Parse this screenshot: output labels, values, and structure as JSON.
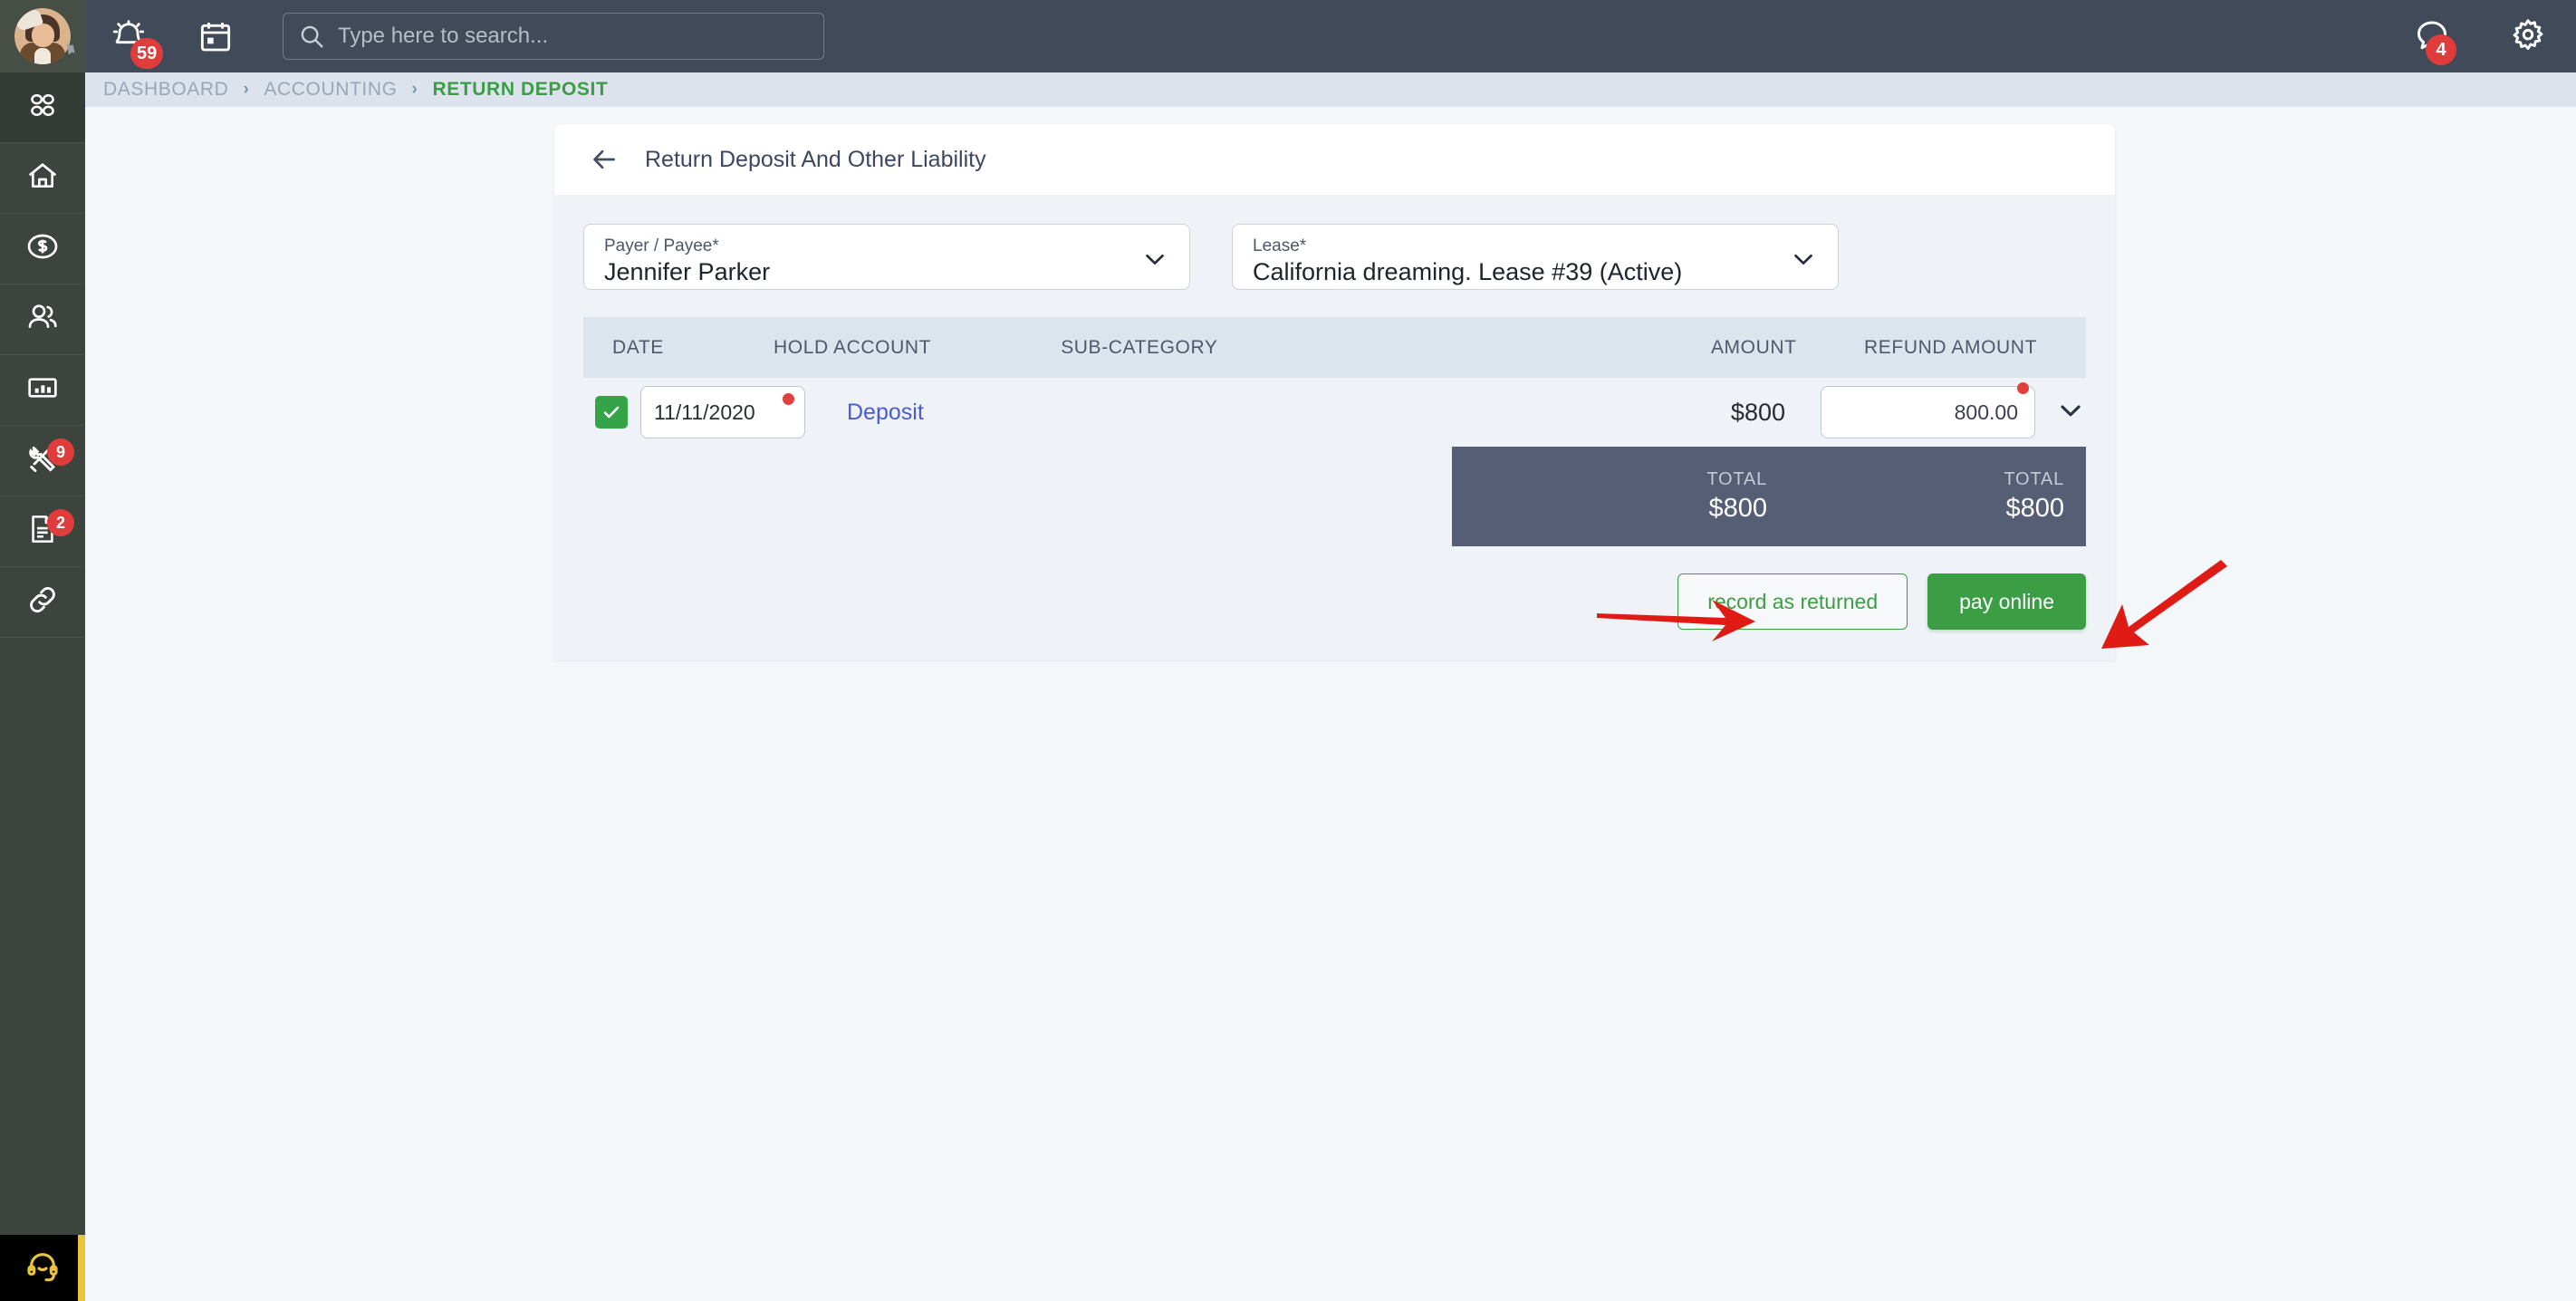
{
  "topbar": {
    "avatar_name": "user-avatar",
    "alarm_badge": "59",
    "chat_badge": "4",
    "search_placeholder": "Type here to search...",
    "search_value": "",
    "icons": {
      "alarm": "alarm-clock-icon",
      "calendar": "calendar-icon",
      "search": "search-icon",
      "chat": "chat-bubble-icon",
      "gear": "gear-icon",
      "pin": "pin-icon"
    }
  },
  "sidebar": {
    "items": [
      {
        "name": "apps-grid-icon",
        "badge": ""
      },
      {
        "name": "home-icon",
        "badge": ""
      },
      {
        "name": "dollar-circle-icon",
        "badge": ""
      },
      {
        "name": "people-icon",
        "badge": ""
      },
      {
        "name": "bar-chart-icon",
        "badge": ""
      },
      {
        "name": "tools-icon",
        "badge": "9"
      },
      {
        "name": "document-icon",
        "badge": "2"
      },
      {
        "name": "link-icon",
        "badge": ""
      }
    ],
    "support": {
      "name": "headset-support-icon"
    }
  },
  "breadcrumb": {
    "items": [
      "DASHBOARD",
      "ACCOUNTING",
      "RETURN DEPOSIT"
    ],
    "separator": "›",
    "active_index": 2
  },
  "card": {
    "title": "Return Deposit And Other Liability",
    "back_icon": "back-arrow-icon"
  },
  "form": {
    "payer": {
      "label": "Payer / Payee*",
      "value": "Jennifer Parker"
    },
    "lease": {
      "label": "Lease*",
      "value": "California dreaming. Lease #39 (Active)"
    }
  },
  "table": {
    "headers": [
      "DATE",
      "HOLD ACCOUNT",
      "SUB-CATEGORY",
      "AMOUNT",
      "REFUND AMOUNT"
    ],
    "rows": [
      {
        "selected": true,
        "date": "11/11/2020",
        "hold_account": "Deposit",
        "sub_category": "",
        "amount": "$800",
        "refund_amount": "800.00"
      }
    ],
    "totals": {
      "amount_label": "TOTAL",
      "amount_value": "$800",
      "refund_label": "TOTAL",
      "refund_value": "$800"
    }
  },
  "actions": {
    "record_as_returned": "record as returned",
    "pay_online": "pay online"
  },
  "annotations": {
    "arrow_color": "#E01B15",
    "arrow_1_target": "record as returned",
    "arrow_2_target": "pay online"
  },
  "colors": {
    "topbar_bg": "#414A58",
    "sidebar_bg": "#3D443D",
    "breadcrumb_bg": "#DCE3EC",
    "page_bg": "#F4F7FA",
    "card_bg": "#EFF3F8",
    "accent_green": "#3C9E44",
    "total_bar": "#565E76",
    "badge_red": "#E13C3C",
    "link_blue": "#4A5BD4",
    "support_yellow": "#E8C33C"
  }
}
